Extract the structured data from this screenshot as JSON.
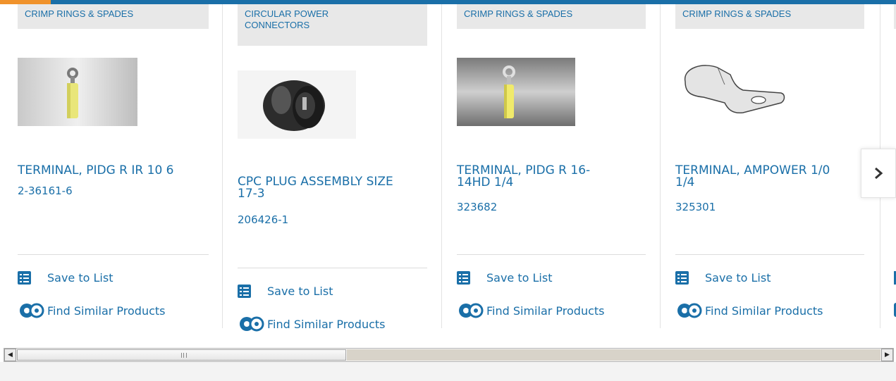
{
  "products": [
    {
      "category": "CRIMP RINGS & SPADES",
      "title_lines": [
        "TERMINAL, PIDG R IR 10 6",
        ""
      ],
      "part_number": "2-36161-6",
      "save_label": "Save to List",
      "similar_label": "Find Similar Products",
      "image": "yellow-ring-terminal"
    },
    {
      "category": "CIRCULAR POWER CONNECTORS",
      "title_lines": [
        "CPC PLUG ASSEMBLY SIZE",
        "17-3"
      ],
      "part_number": "206426-1",
      "save_label": "Save to List",
      "similar_label": "Find Similar Products",
      "image": "black-cpc-plug"
    },
    {
      "category": "CRIMP RINGS & SPADES",
      "title_lines": [
        "TERMINAL, PIDG R 16-",
        "14HD 1/4"
      ],
      "part_number": "323682",
      "save_label": "Save to List",
      "similar_label": "Find Similar Products",
      "image": "yellow-ring-terminal"
    },
    {
      "category": "CRIMP RINGS & SPADES",
      "title_lines": [
        "TERMINAL, AMPOWER 1/0",
        "1/4"
      ],
      "part_number": "325301",
      "save_label": "Save to List",
      "similar_label": "Find Similar Products",
      "image": "metal-lug-terminal"
    }
  ],
  "carousel": {
    "next_icon": "chevron-right-icon"
  },
  "colors": {
    "link": "#1a6fa8",
    "accent": "#f0922b",
    "category_bg": "#e8e8e8"
  }
}
